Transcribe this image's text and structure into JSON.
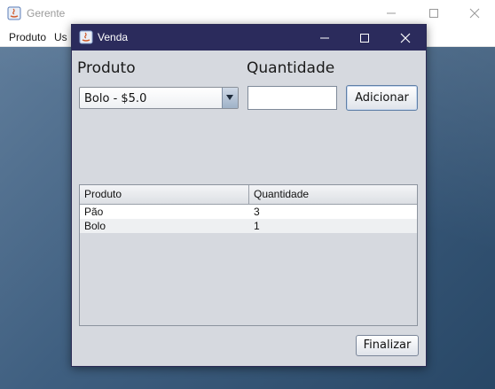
{
  "background_window": {
    "title": "Gerente",
    "menu": [
      "Produto",
      "Us"
    ]
  },
  "dialog": {
    "title": "Venda",
    "produto_label": "Produto",
    "quantidade_label": "Quantidade",
    "produto_selected": "Bolo - $5.0",
    "quantidade_value": "",
    "add_button": "Adicionar",
    "finish_button": "Finalizar",
    "table": {
      "columns": [
        "Produto",
        "Quantidade"
      ],
      "rows": [
        [
          "Pão",
          "3"
        ],
        [
          "Bolo",
          "1"
        ]
      ]
    }
  },
  "colors": {
    "dialog_titlebar": "#2b2b5c",
    "dialog_body": "#d6d9df",
    "desktop": "#3f5f80"
  },
  "icons": [
    "java-app-icon",
    "minimize-icon",
    "maximize-icon",
    "close-icon",
    "combo-arrow-icon"
  ]
}
